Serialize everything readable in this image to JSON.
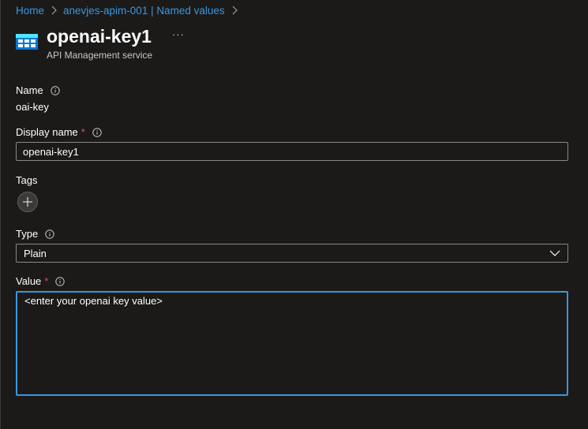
{
  "breadcrumb": {
    "items": [
      "Home",
      "anevjes-apim-001 | Named values"
    ]
  },
  "header": {
    "title": "openai-key1",
    "subtitle": "API Management service",
    "more_label": "···"
  },
  "form": {
    "name": {
      "label": "Name",
      "value": "oai-key"
    },
    "display_name": {
      "label": "Display name",
      "required_marker": "*",
      "value": "openai-key1"
    },
    "tags": {
      "label": "Tags"
    },
    "type": {
      "label": "Type",
      "selected": "Plain"
    },
    "value": {
      "label": "Value",
      "required_marker": "*",
      "value": "<enter your openai key value>"
    }
  },
  "colors": {
    "background": "#1b1a19",
    "link": "#3a96dd",
    "required": "#e74856",
    "focus_border": "#3a96dd"
  },
  "icons": [
    "api-management-icon",
    "info-icon",
    "add-icon",
    "chevron-down-icon",
    "chevron-right-icon"
  ]
}
